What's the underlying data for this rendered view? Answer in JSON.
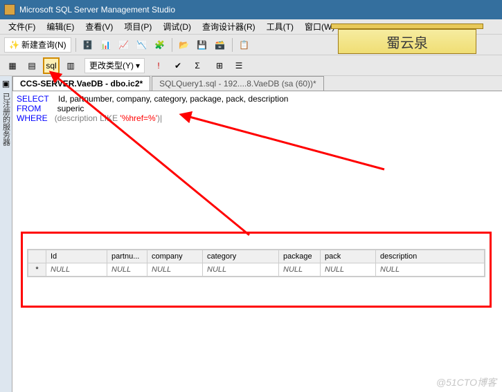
{
  "title": "Microsoft SQL Server Management Studio",
  "menu": {
    "file": "文件(F)",
    "edit": "编辑(E)",
    "view": "查看(V)",
    "project": "项目(P)",
    "debug": "调试(D)",
    "qdesigner": "查询设计器(R)",
    "tools": "工具(T)",
    "window": "窗口(W)"
  },
  "toolbar": {
    "newquery": "新建查询(N)",
    "changetype": "更改类型(Y)"
  },
  "tabs": {
    "active": "CCS-SERVER.VaeDB - dbo.ic2*",
    "inactive": "SQLQuery1.sql - 192....8.VaeDB (sa (60))*"
  },
  "sql": {
    "kw_select": "SELECT",
    "cols": "Id, partnumber, company, category, package, pack, description",
    "kw_from": "FROM",
    "tbl": "superic",
    "kw_where": "WHERE",
    "expr_open": "(description ",
    "kw_like": "LIKE",
    "str": " '%href=%'",
    "expr_close": ")|"
  },
  "grid": {
    "headers": [
      "",
      "Id",
      "partnu...",
      "company",
      "category",
      "package",
      "pack",
      "description"
    ],
    "row": [
      "*",
      "NULL",
      "NULL",
      "NULL",
      "NULL",
      "NULL",
      "NULL",
      "NULL"
    ]
  },
  "sidepanel": "已注册的服务器",
  "sign": "蜀云泉",
  "watermark": "@51CTO博客"
}
